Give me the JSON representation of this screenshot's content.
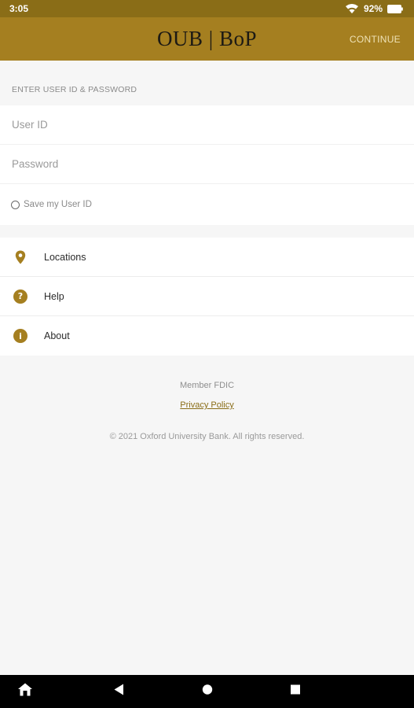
{
  "status_bar": {
    "time": "3:05",
    "battery": "92%",
    "icons": [
      "wifi-icon",
      "battery-icon"
    ]
  },
  "app_bar": {
    "logo_text": "OUB | BoP",
    "continue_label": "CONTINUE"
  },
  "login": {
    "section_header": "ENTER USER ID & PASSWORD",
    "user_id_placeholder": "User ID",
    "user_id_value": "",
    "password_placeholder": "Password",
    "password_value": "",
    "save_label": "Save my User ID",
    "save_checked": false
  },
  "menu": {
    "items": [
      {
        "label": "Locations",
        "icon": "location-pin-icon"
      },
      {
        "label": "Help",
        "icon": "help-icon",
        "glyph": "?"
      },
      {
        "label": "About",
        "icon": "info-icon",
        "glyph": "i"
      }
    ]
  },
  "footer": {
    "member": "Member FDIC",
    "privacy": "Privacy Policy",
    "copyright": "© 2021 Oxford University Bank. All rights reserved."
  },
  "nav_bar": {
    "icons": [
      "home-icon",
      "back-icon",
      "home-circle-icon",
      "recents-icon"
    ]
  },
  "colors": {
    "brand": "#a57f20",
    "status_bar": "#8a6d17",
    "background": "#f6f6f6"
  }
}
